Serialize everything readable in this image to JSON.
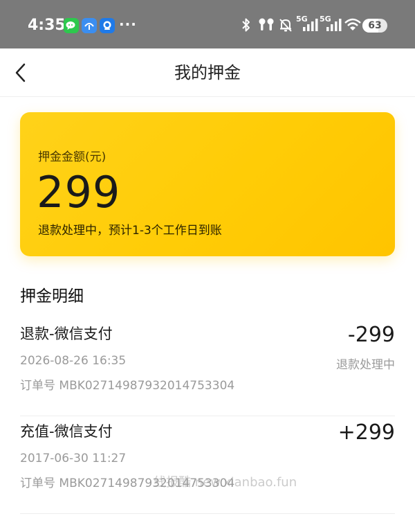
{
  "status_bar": {
    "time": "4:35",
    "more": "···",
    "battery": "63",
    "battery_level": 0.63,
    "network_5g_1": "5G",
    "network_5g_2": "5G",
    "icons": [
      "wechat-icon",
      "airdrop-app-icon",
      "chat-app-icon",
      "bluetooth-icon",
      "earbuds-icon",
      "mute-icon",
      "signal-icon",
      "signal-icon",
      "wifi-icon",
      "battery-icon"
    ]
  },
  "nav": {
    "title": "我的押金",
    "back_icon": "back-arrow-icon"
  },
  "deposit": {
    "label": "押金金额(元)",
    "amount": "299",
    "status": "退款处理中，预计1-3个工作日到账",
    "accent_color": "#ffcc06"
  },
  "details": {
    "title": "押金明细",
    "records": [
      {
        "title": "退款-微信支付",
        "time": "2026-08-26 16:35",
        "order": "订单号 MBK02714987932014753304",
        "amount": "-299",
        "status": "退款处理中"
      },
      {
        "title": "充值-微信支付",
        "time": "2017-06-30 11:27",
        "order": "订单号 MBK02714987932014753304",
        "amount": "+299",
        "status": ""
      }
    ]
  },
  "watermark": "线报酷  new.xianbao.fun"
}
